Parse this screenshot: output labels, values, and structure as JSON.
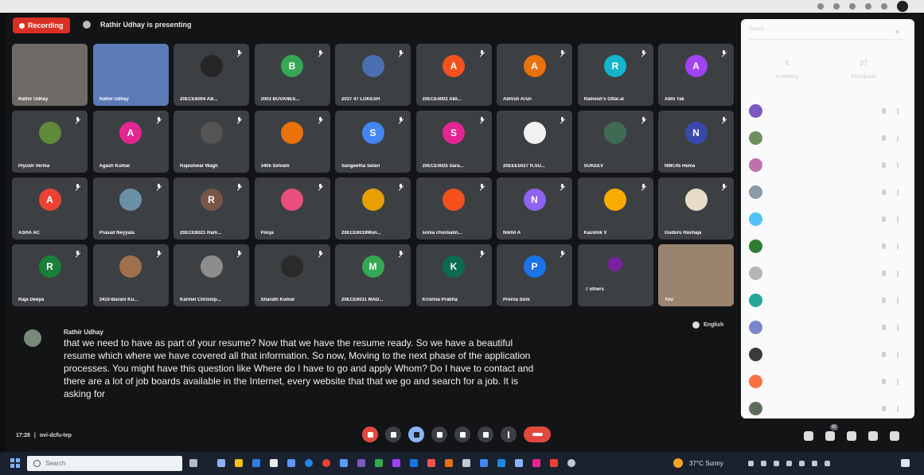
{
  "meeting": {
    "recording_label": "Recording",
    "presenting_label": "Rathir Udhay is presenting",
    "meeting_time": "17:28",
    "meeting_code": "ovi-dcfu-tep"
  },
  "participants_grid": [
    {
      "name": "Rathir Udhay",
      "avatar_letter": "",
      "color": "#6d6a66",
      "kind": "video"
    },
    {
      "name": "Rathir Udhay",
      "avatar_letter": "",
      "color": "#5b7bb6",
      "kind": "video"
    },
    {
      "name": "20ECE6004 AB...",
      "avatar_letter": "",
      "color": "#262626",
      "kind": "photo"
    },
    {
      "name": "2003 BUVANES...",
      "avatar_letter": "B",
      "color": "#34a853",
      "kind": "letter"
    },
    {
      "name": "2037 47 LOKESH",
      "avatar_letter": "",
      "color": "#4a6fb0",
      "kind": "photo"
    },
    {
      "name": "20ECE4002 ABI...",
      "avatar_letter": "A",
      "color": "#f4511e",
      "kind": "letter"
    },
    {
      "name": "Abhish Arun",
      "avatar_letter": "A",
      "color": "#e8710a",
      "kind": "letter"
    },
    {
      "name": "Ramesh's Ottar.al",
      "avatar_letter": "R",
      "color": "#12b5cb",
      "kind": "letter"
    },
    {
      "name": "Abhi Tak",
      "avatar_letter": "A",
      "color": "#a142f4",
      "kind": "letter"
    },
    {
      "name": "Piyush Verma",
      "avatar_letter": "",
      "color": "#5f8a3a",
      "kind": "photo"
    },
    {
      "name": "Agash Kumar",
      "avatar_letter": "A",
      "color": "#e52592",
      "kind": "letter"
    },
    {
      "name": "Rajeshwar Wagh",
      "avatar_letter": "",
      "color": "#555555",
      "kind": "photo"
    },
    {
      "name": "3405 Selvam",
      "avatar_letter": "",
      "color": "#e8710a",
      "kind": "photo"
    },
    {
      "name": "Sangeetha Selari",
      "avatar_letter": "S",
      "color": "#4285f4",
      "kind": "letter"
    },
    {
      "name": "20ECE4025 Sara...",
      "avatar_letter": "S",
      "color": "#e52592",
      "kind": "letter"
    },
    {
      "name": "20EEE5027 R.SU...",
      "avatar_letter": "",
      "color": "#f1f1f1",
      "kind": "photo"
    },
    {
      "name": "SUKEEV",
      "avatar_letter": "",
      "color": "#3f6b55",
      "kind": "photo"
    },
    {
      "name": "NMC45 Hema",
      "avatar_letter": "N",
      "color": "#3949ab",
      "kind": "letter"
    },
    {
      "name": "ASHA AC",
      "avatar_letter": "A",
      "color": "#ea4335",
      "kind": "letter"
    },
    {
      "name": "Prasad Neyyala",
      "avatar_letter": "",
      "color": "#6a8fa6",
      "kind": "photo"
    },
    {
      "name": "20ECE6021 Ram...",
      "avatar_letter": "R",
      "color": "#795548",
      "kind": "letter"
    },
    {
      "name": "Pooja",
      "avatar_letter": "",
      "color": "#e84f7d",
      "kind": "photo"
    },
    {
      "name": "20ECE6019Mun...",
      "avatar_letter": "",
      "color": "#e8a000",
      "kind": "photo"
    },
    {
      "name": "sonia chockalin...",
      "avatar_letter": "",
      "color": "#f4511e",
      "kind": "photo"
    },
    {
      "name": "Nikhil A",
      "avatar_letter": "N",
      "color": "#8e63f2",
      "kind": "letter"
    },
    {
      "name": "Kaushik V",
      "avatar_letter": "",
      "color": "#f9ab00",
      "kind": "photo"
    },
    {
      "name": "Guduru Ravhaja",
      "avatar_letter": "",
      "color": "#e6dcc8",
      "kind": "photo"
    },
    {
      "name": "Raja Deepa",
      "avatar_letter": "R",
      "color": "#188038",
      "kind": "letter"
    },
    {
      "name": "3410-Barani Ku...",
      "avatar_letter": "",
      "color": "#a0714f",
      "kind": "photo"
    },
    {
      "name": "Karmel Christop...",
      "avatar_letter": "",
      "color": "#8d8d8d",
      "kind": "photo"
    },
    {
      "name": "Sharath Kumar",
      "avatar_letter": "",
      "color": "#2a2a2a",
      "kind": "photo"
    },
    {
      "name": "20ECE6011 MAD...",
      "avatar_letter": "M",
      "color": "#34a853",
      "kind": "letter"
    },
    {
      "name": "Krishna Prabha",
      "avatar_letter": "K",
      "color": "#0b6b4f",
      "kind": "letter"
    },
    {
      "name": "Prerna Soni",
      "avatar_letter": "P",
      "color": "#1a73e8",
      "kind": "letter"
    },
    {
      "name": "7 others",
      "avatar_letter": "",
      "color": "#7b1fa2",
      "kind": "others"
    },
    {
      "name": "You",
      "avatar_letter": "",
      "color": "#9a8470",
      "kind": "video"
    }
  ],
  "caption": {
    "speaker": "Rathir Udhay",
    "text": "that we need to have as part of your resume? Now that we have the resume ready. So we have a beautiful resume which where we have covered all that information. So now, Moving to the next phase of the application processes. You might have this question like Where do I have to go and apply Whom? Do I have to contact and there are a lot of job boards available in the Internet, every website that that we go and search for a job. It is asking for"
  },
  "language": "English",
  "people_panel": {
    "search_placeholder": "Search",
    "stat_left_value": "6",
    "stat_left_label": "In meeting",
    "stat_right_value": "37",
    "stat_right_label": "Participants",
    "rows": [
      {
        "color": "#7e57c2"
      },
      {
        "color": "#6f8f5f"
      },
      {
        "color": "#c26fae"
      },
      {
        "color": "#8a9aa8"
      },
      {
        "color": "#4fc3f7"
      },
      {
        "color": "#2e7d32"
      },
      {
        "color": "#b5b5b5"
      },
      {
        "color": "#26a69a"
      },
      {
        "color": "#7986cb"
      },
      {
        "color": "#3a3a3a"
      },
      {
        "color": "#ff7043"
      },
      {
        "color": "#5d6d5d"
      }
    ]
  },
  "controls": {
    "people_count_badge": "42"
  },
  "taskbar": {
    "search_placeholder": "Search",
    "weather": "37°C Sunny"
  }
}
